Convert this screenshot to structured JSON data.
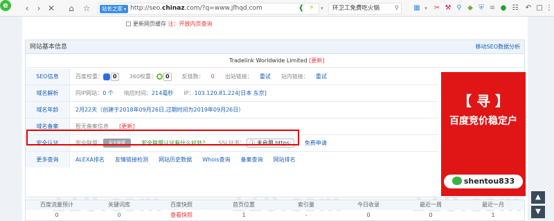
{
  "browser": {
    "url_prefix": "http://seo.",
    "url_domain": "chinaz",
    "url_suffix": ".com/?q=www.jfhqd.com",
    "site_badge": "站长之家",
    "search_text": "环卫工免费吃火锅"
  },
  "cache": {
    "label": "更新网页缓存",
    "note": "注：开放内页查询"
  },
  "panel": {
    "title": "网站基本信息",
    "right_link": "移动SEO数据分析",
    "company": "Tradelink Worldwide Limited",
    "company_update": "[更新]"
  },
  "seo": {
    "label": "SEO信息",
    "baidu_label": "百度权重：",
    "baidu_value": "0",
    "s360_label": "360权重：",
    "s360_value": "0",
    "backlinks_label": "反链数：",
    "backlinks_value": "0",
    "outlinks_label": "出站链接：",
    "outlinks_value": "重试",
    "inlinks_label": "站内链接：",
    "inlinks_value": "重试"
  },
  "dns": {
    "label": "域名解析",
    "sameip_label": "同IP网站：",
    "sameip_value": "0 个",
    "resp_label": "响应时间：",
    "resp_value": "214毫秒",
    "ip_label": "IP：",
    "ip_value": "103.120.81.224[日本 东京]"
  },
  "age": {
    "label": "域名年龄",
    "value": "2月22天（创建于2018年09月26日,过期时间为2019年09月26日）"
  },
  "icp": {
    "label": "域名备案",
    "value": "暂无备案信息",
    "update": "[更新]"
  },
  "security": {
    "label": "安全认证",
    "alliance_label": "安全联盟：",
    "seal_text": "安全联盟",
    "alliance_link": "安全联盟认证有什么好处？",
    "ssl_label": "SSL证书：",
    "ssl_box": "ⓘ 未启用 https:",
    "ssl_link": "免费申请"
  },
  "more": {
    "label": "更多查询",
    "links": [
      "ALEXA排名",
      "友情链接检测",
      "网站历史数据",
      "Whois查询",
      "备案查询",
      "网站排名"
    ]
  },
  "ad": {
    "char": "【 寻 】",
    "text": "百度竞价稳定户",
    "pill": "shentou833"
  },
  "stats": {
    "headers": [
      "百度流量预计",
      "关键词库",
      "百度快照",
      "首页位置",
      "索引量",
      "今日收录",
      "最近一周",
      "最近一月"
    ],
    "values": [
      "0",
      "0",
      "查看快照",
      "1",
      "-",
      "0",
      "0",
      "1"
    ]
  },
  "watermark": "110.com",
  "colors": {
    "accent": "#1a5fb4",
    "highlight": "#e30000",
    "ad_bg": "#e01515"
  }
}
